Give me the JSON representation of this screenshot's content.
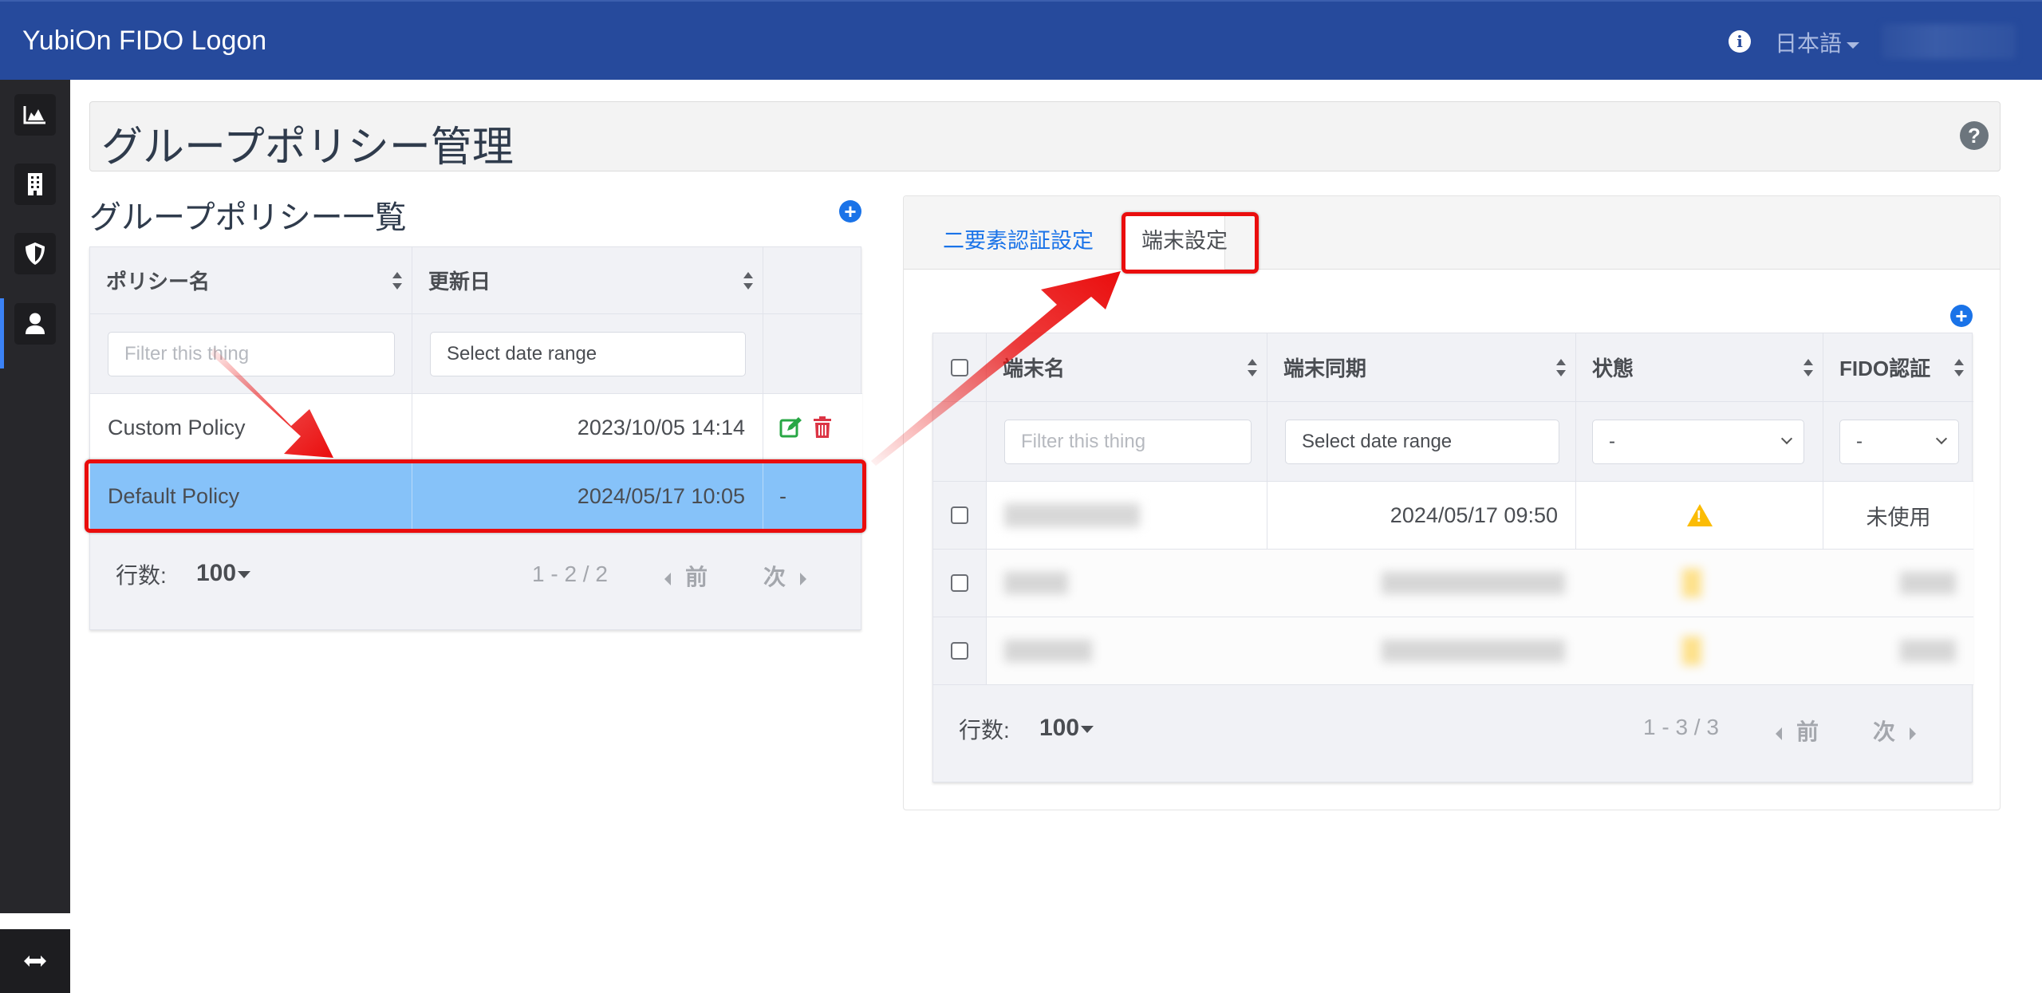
{
  "header": {
    "app_title": "YubiOn FIDO Logon",
    "info_icon": "info-circle-icon",
    "language": "日本語",
    "user_name_blurred": true
  },
  "sidebar": {
    "items": [
      {
        "name": "dashboard",
        "icon": "area-chart-icon",
        "active": false
      },
      {
        "name": "organization",
        "icon": "building-icon",
        "active": false
      },
      {
        "name": "group-policy",
        "icon": "shield-icon",
        "active": true
      },
      {
        "name": "users",
        "icon": "user-icon",
        "active": false
      }
    ],
    "toggle_icon": "expand-horizontal-icon"
  },
  "page": {
    "title": "グループポリシー管理",
    "help_icon": "question-circle-icon"
  },
  "policy_list": {
    "heading": "グループポリシー一覧",
    "add_icon": "plus-circle-icon",
    "columns": [
      "ポリシー名",
      "更新日",
      ""
    ],
    "filters": {
      "name_placeholder": "Filter this thing",
      "date_placeholder": "Select date range"
    },
    "rows": [
      {
        "name": "Custom Policy",
        "updated": "2023/10/05 14:14",
        "actions": [
          "edit",
          "delete"
        ],
        "selected": false
      },
      {
        "name": "Default Policy",
        "updated": "2024/05/17 10:05",
        "actions_text": "-",
        "selected": true
      }
    ],
    "footer": {
      "rows_label": "行数:",
      "rows_per_page": "100",
      "range": "1 - 2 / 2",
      "prev": "前",
      "next": "次"
    }
  },
  "detail_panel": {
    "tabs": [
      {
        "label": "二要素認証設定",
        "active": false
      },
      {
        "label": "端末設定",
        "active": true
      }
    ],
    "add_icon": "plus-circle-icon",
    "columns": [
      "端末名",
      "端末同期",
      "状態",
      "FIDO認証"
    ],
    "filters": {
      "name_placeholder": "Filter this thing",
      "date_placeholder": "Select date range",
      "status_value": "-",
      "fido_value": "-"
    },
    "rows": [
      {
        "name": "(blurred)",
        "synced": "2024/05/17 09:50",
        "status_icon": "warning-icon",
        "fido": "未使用",
        "blurred": false
      },
      {
        "name": "(blurred)",
        "synced": "(blurred)",
        "status_icon": "warning-icon",
        "fido": "(blurred)",
        "blurred": true
      },
      {
        "name": "(blurred)",
        "synced": "(blurred)",
        "status_icon": "warning-icon",
        "fido": "(blurred)",
        "blurred": true
      }
    ],
    "footer": {
      "rows_label": "行数:",
      "rows_per_page": "100",
      "range": "1 - 3 / 3",
      "prev": "前",
      "next": "次"
    }
  },
  "annotations": {
    "highlight_color": "#ea0d0d",
    "callouts": [
      "highlight-default-policy-row",
      "highlight-device-settings-tab"
    ]
  },
  "colors": {
    "header_bg": "#264a9c",
    "sidebar_bg": "#27272b",
    "accent": "#1a73e8",
    "selected_row": "#86c2f9",
    "warning": "#fbbc05",
    "edit": "#28a745",
    "delete": "#dc3545"
  }
}
